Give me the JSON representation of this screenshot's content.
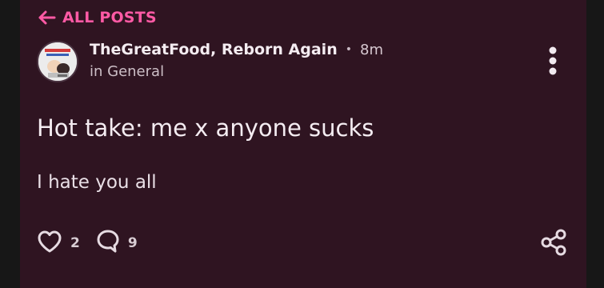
{
  "nav": {
    "back_label": "ALL POSTS",
    "back_icon": "arrow-left-icon"
  },
  "post": {
    "author": "TheGreatFood, Reborn Again",
    "separator": "•",
    "time_ago": "8m",
    "category": "in General",
    "title": "Hot take: me x anyone sucks",
    "body": "I hate you all",
    "likes": "2",
    "comments": "9"
  },
  "icons": {
    "more": "more-vertical-icon",
    "like": "heart-icon",
    "comment": "comment-icon",
    "share": "share-icon"
  },
  "colors": {
    "background": "#2f1421",
    "accent": "#ff5aa5",
    "text": "#f4ecf1",
    "muted": "#cdbfc7"
  }
}
